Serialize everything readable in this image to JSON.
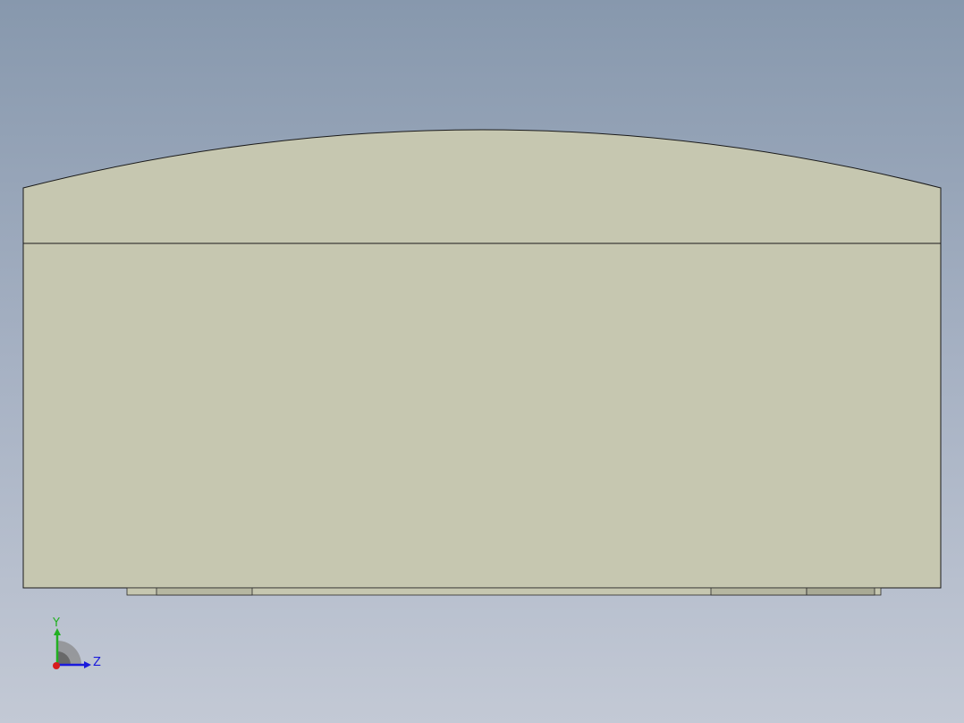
{
  "viewport": {
    "background_top": "#8798ad",
    "background_bottom": "#c3c9d5"
  },
  "model": {
    "face_color": "#c6c7b0",
    "edge_color": "#1a1a1a",
    "foot_color": "#a9aa95"
  },
  "triad": {
    "y_label": "Y",
    "z_label": "Z",
    "y_color": "#22b022",
    "z_color": "#1a1adc",
    "x_color": "#d81c1c"
  }
}
